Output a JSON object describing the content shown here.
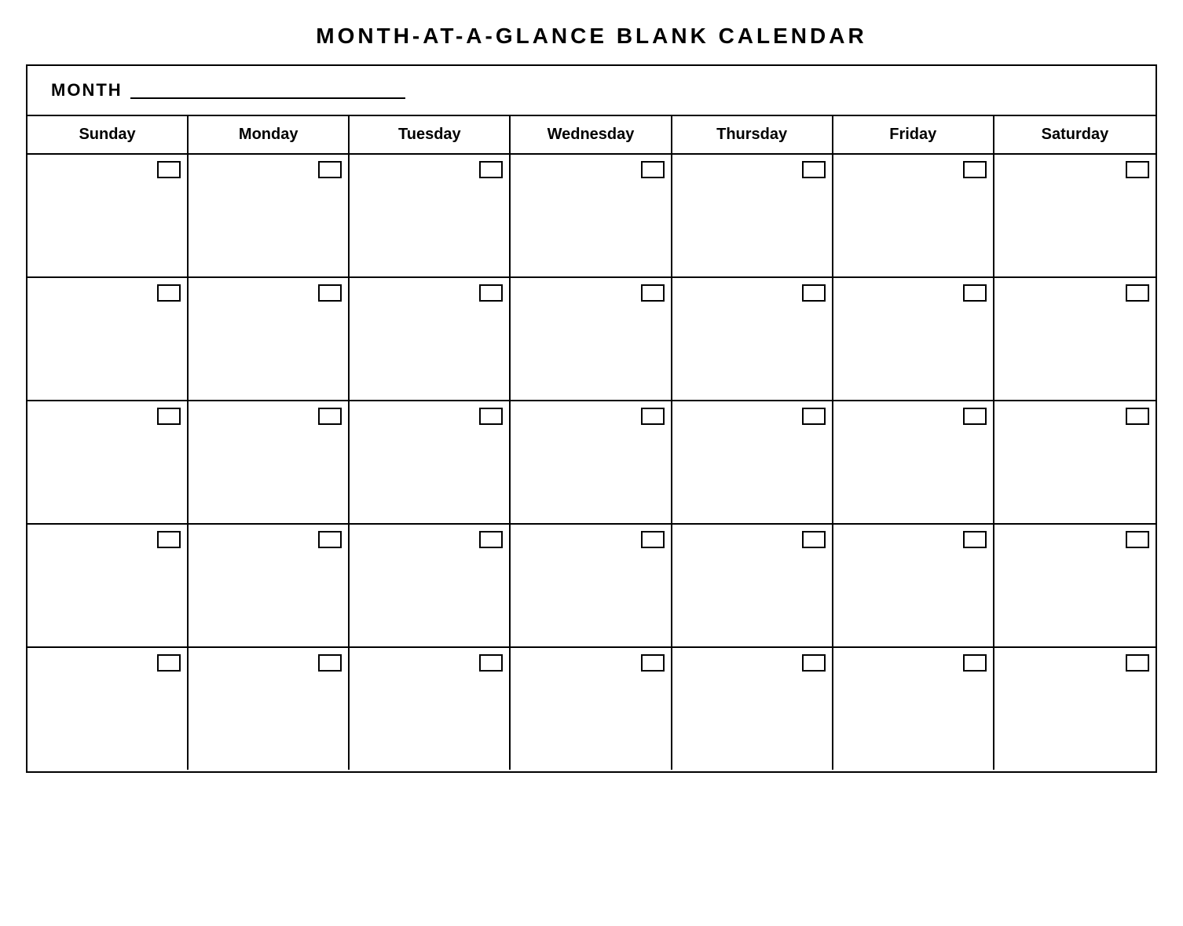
{
  "title": "MONTH-AT-A-GLANCE  BLANK  CALENDAR",
  "month_label": "MONTH",
  "days": [
    "Sunday",
    "Monday",
    "Tuesday",
    "Wednesday",
    "Thursday",
    "Friday",
    "Saturday"
  ],
  "rows": 5
}
